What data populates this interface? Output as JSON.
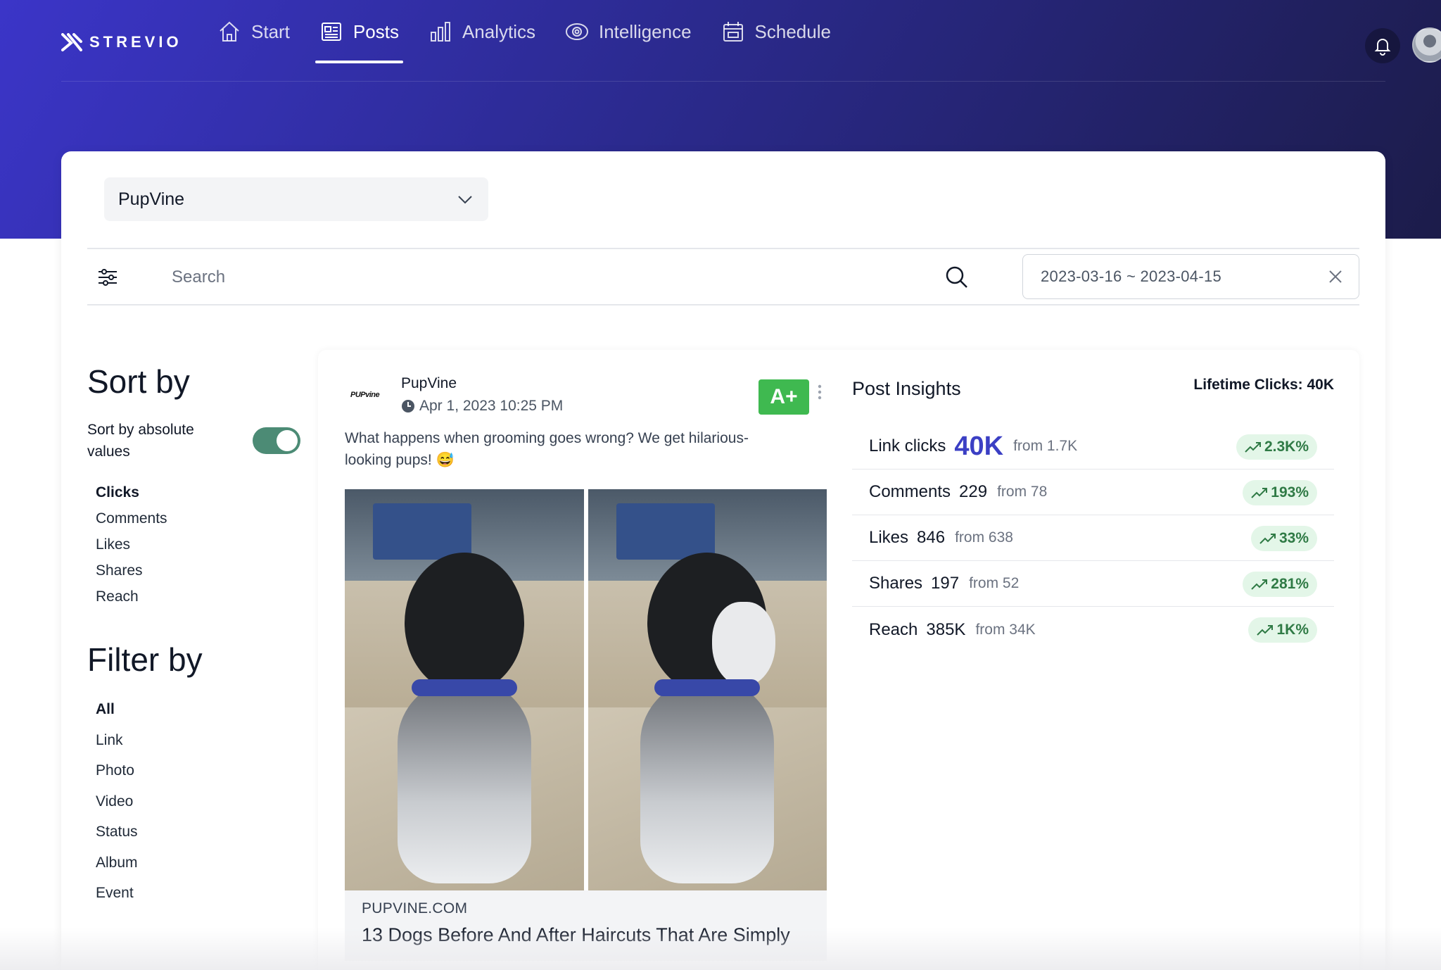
{
  "brand": {
    "name": "STREVIO"
  },
  "nav": {
    "items": [
      {
        "label": "Start",
        "icon": "home-icon"
      },
      {
        "label": "Posts",
        "icon": "document-icon",
        "active": true
      },
      {
        "label": "Analytics",
        "icon": "bar-chart-icon"
      },
      {
        "label": "Intelligence",
        "icon": "eye-icon"
      },
      {
        "label": "Schedule",
        "icon": "calendar-icon"
      }
    ]
  },
  "account_select": {
    "value": "PupVine"
  },
  "search": {
    "placeholder": "Search",
    "date_range": "2023-03-16 ~ 2023-04-15"
  },
  "sort": {
    "title": "Sort by",
    "toggle_label": "Sort by absolute values",
    "toggle_on": true,
    "options": [
      "Clicks",
      "Comments",
      "Likes",
      "Shares",
      "Reach"
    ],
    "selected": "Clicks"
  },
  "filter": {
    "title": "Filter by",
    "options": [
      "All",
      "Link",
      "Photo",
      "Video",
      "Status",
      "Album",
      "Event"
    ],
    "selected": "All"
  },
  "post": {
    "page_logo_text": "PUPvine",
    "author": "PupVine",
    "date": "Apr 1, 2023 10:25 PM",
    "grade": "A+",
    "caption": "What happens when grooming goes wrong? We get hilarious-looking pups! 😅",
    "link_domain": "PUPVINE.COM",
    "link_title": "13 Dogs Before And After Haircuts That Are Simply"
  },
  "insights": {
    "title": "Post Insights",
    "lifetime": "Lifetime Clicks: 40K",
    "metrics": [
      {
        "name": "Link clicks",
        "value": "40K",
        "from": "from 1.7K",
        "change": "2.3K%"
      },
      {
        "name": "Comments",
        "value": "229",
        "from": "from 78",
        "change": "193%"
      },
      {
        "name": "Likes",
        "value": "846",
        "from": "from 638",
        "change": "33%"
      },
      {
        "name": "Shares",
        "value": "197",
        "from": "from 52",
        "change": "281%"
      },
      {
        "name": "Reach",
        "value": "385K",
        "from": "from 34K",
        "change": "1K%"
      }
    ],
    "positive_color": "#2f7a45"
  },
  "colors": {
    "accent": "#3b3fc4",
    "grade": "#3fb950",
    "toggle": "#4c8b75"
  }
}
